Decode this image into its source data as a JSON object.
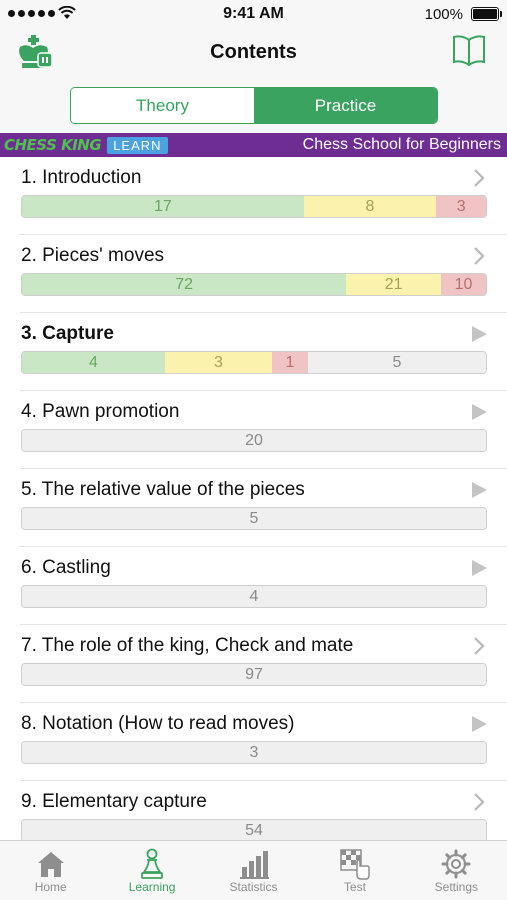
{
  "status_bar": {
    "time": "9:41 AM",
    "battery": "100%"
  },
  "header": {
    "title": "Contents"
  },
  "segment": {
    "theory": "Theory",
    "practice": "Practice",
    "selected": "Practice"
  },
  "banner": {
    "brand": "CHESS KING",
    "badge": "LEARN",
    "course": "Chess School for Beginners"
  },
  "lessons": [
    {
      "title": "1. Introduction",
      "arrow": "chevron",
      "green": 17,
      "yellow": 8,
      "red": 3,
      "gray": null
    },
    {
      "title": "2. Pieces' moves",
      "arrow": "chevron",
      "green": 72,
      "yellow": 21,
      "red": 10,
      "gray": null
    },
    {
      "title": "3. Capture",
      "arrow": "triangle",
      "current": true,
      "green": 4,
      "yellow": 3,
      "red": 1,
      "gray": 5
    },
    {
      "title": "4. Pawn promotion",
      "arrow": "triangle",
      "green": null,
      "yellow": null,
      "red": null,
      "gray": 20
    },
    {
      "title": "5. The relative value of the pieces",
      "arrow": "triangle",
      "green": null,
      "yellow": null,
      "red": null,
      "gray": 5
    },
    {
      "title": "6. Castling",
      "arrow": "triangle",
      "green": null,
      "yellow": null,
      "red": null,
      "gray": 4
    },
    {
      "title": "7. The role of the king, Check and mate",
      "arrow": "chevron",
      "green": null,
      "yellow": null,
      "red": null,
      "gray": 97
    },
    {
      "title": "8. Notation (How to read moves)",
      "arrow": "triangle",
      "green": null,
      "yellow": null,
      "red": null,
      "gray": 3
    },
    {
      "title": "9. Elementary capture",
      "arrow": "chevron",
      "green": null,
      "yellow": null,
      "red": null,
      "gray": 54
    }
  ],
  "tabs": [
    {
      "label": "Home",
      "icon": "home-icon"
    },
    {
      "label": "Learning",
      "icon": "pawn-icon",
      "active": true
    },
    {
      "label": "Statistics",
      "icon": "bar-chart-icon"
    },
    {
      "label": "Test",
      "icon": "board-hand-icon"
    },
    {
      "label": "Settings",
      "icon": "gear-icon"
    }
  ],
  "colors": {
    "accent": "#3aa35f",
    "banner": "#6d2d92",
    "green": "#c9e7c4",
    "yellow": "#fbf3ad",
    "red": "#f0c4c4",
    "gray": "#efefef"
  }
}
